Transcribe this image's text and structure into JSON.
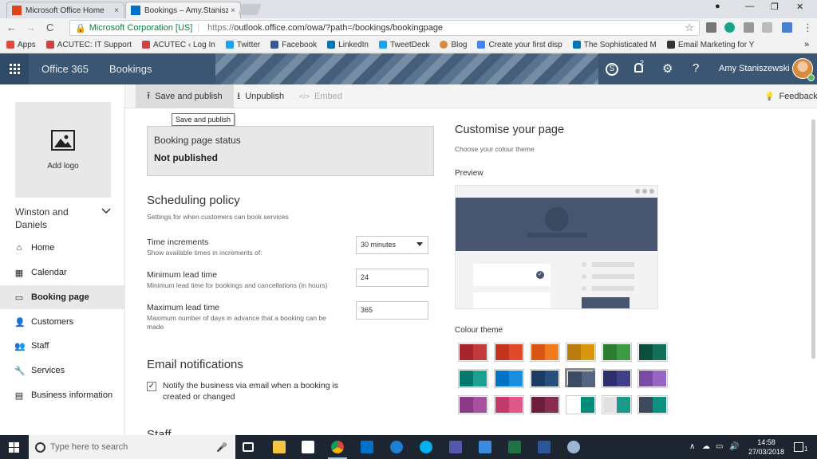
{
  "browser": {
    "tabs": [
      {
        "title": "Microsoft Office Home",
        "close": "×"
      },
      {
        "title": "Bookings – Amy.Stanisze",
        "close": "×"
      }
    ],
    "window_controls": {
      "user": "●",
      "minimize": "—",
      "maximize": "❐",
      "close": "✕"
    },
    "nav": {
      "back": "←",
      "forward": "→",
      "reload": "C"
    },
    "secure_label": "Microsoft Corporation [US]",
    "url_scheme": "https://",
    "url_rest": "outlook.office.com/owa/?path=/bookings/bookingpage",
    "star": "☆",
    "menu": "⋮",
    "bookmarks": [
      {
        "label": "Apps",
        "color": "#e04b3a"
      },
      {
        "label": "ACUTEC: IT Support",
        "color": "#c44"
      },
      {
        "label": "ACUTEC ‹ Log In",
        "color": "#c44"
      },
      {
        "label": "Twitter",
        "color": "#1da1f2"
      },
      {
        "label": "Facebook",
        "color": "#3b5998"
      },
      {
        "label": "LinkedIn",
        "color": "#0077b5"
      },
      {
        "label": "TweetDeck",
        "color": "#1da1f2"
      },
      {
        "label": "Blog",
        "color": "#d98b3a"
      },
      {
        "label": "Create your first disp",
        "color": "#4285f4"
      },
      {
        "label": "The Sophisticated M",
        "color": "#0077b5"
      },
      {
        "label": "Email Marketing for Y",
        "color": "#333"
      }
    ],
    "bookmarks_more": "»"
  },
  "o365": {
    "brand": "Office 365",
    "app": "Bookings",
    "notification_count": "2",
    "icons": {
      "skype": "S",
      "bell": "🔔",
      "settings": "⚙",
      "help": "?"
    },
    "user_name": "Amy Staniszewski"
  },
  "sidebar": {
    "add_logo": "Add logo",
    "business_name": "Winston and Daniels",
    "chevron": "⌄",
    "items": [
      {
        "label": "Home",
        "icon": "⌂"
      },
      {
        "label": "Calendar",
        "icon": "▦"
      },
      {
        "label": "Booking page",
        "icon": "▭"
      },
      {
        "label": "Customers",
        "icon": "👤"
      },
      {
        "label": "Staff",
        "icon": "👥"
      },
      {
        "label": "Services",
        "icon": "🔧"
      },
      {
        "label": "Business information",
        "icon": "▤"
      }
    ]
  },
  "actionbar": {
    "save_publish": "Save and publish",
    "save_icon": "⭱",
    "unpublish": "Unpublish",
    "unpublish_icon": "⭳",
    "embed": "Embed",
    "embed_icon": "</>",
    "feedback": "Feedback",
    "feedback_icon": "💡",
    "tooltip": "Save and publish"
  },
  "status": {
    "title": "Booking page status",
    "value": "Not published"
  },
  "scheduling": {
    "title": "Scheduling policy",
    "subtitle": "Settings for when customers can book services",
    "time_increments": {
      "label": "Time increments",
      "help": "Show available times in increments of:",
      "value": "30 minutes"
    },
    "min_lead": {
      "label": "Minimum lead time",
      "help": "Minimum lead time for bookings and cancellations (in hours)",
      "value": "24"
    },
    "max_lead": {
      "label": "Maximum lead time",
      "help": "Maximum number of days in advance that a booking can be made",
      "value": "365"
    }
  },
  "email": {
    "title": "Email notifications",
    "notify_label": "Notify the business via email when a booking is created or changed",
    "notify_checked": true,
    "check_mark": "✓"
  },
  "next_section": "Staff",
  "customise": {
    "title": "Customise your page",
    "subtitle": "Choose your colour theme",
    "preview_label": "Preview",
    "theme_label": "Colour theme",
    "preview_color": "#475570",
    "swatches": [
      [
        "#a4262c",
        "#c23a3a"
      ],
      [
        "#c5341f",
        "#e04a2b"
      ],
      [
        "#d85611",
        "#f07b1f"
      ],
      [
        "#b97a10",
        "#d9970f"
      ],
      [
        "#2d7d32",
        "#3c9a42"
      ],
      [
        "#0c4f3f",
        "#15705a"
      ],
      [
        "#03786d",
        "#1aa18f"
      ],
      [
        "#0072c6",
        "#1b8ee0"
      ],
      [
        "#1a3c63",
        "#274f7d"
      ],
      [
        "#3d4a63",
        "#556480"
      ],
      [
        "#2b2f6b",
        "#403f8a"
      ],
      [
        "#7a4ca3",
        "#9866c2"
      ],
      [
        "#8a3a86",
        "#a8529f"
      ],
      [
        "#c23a6b",
        "#df5688"
      ],
      [
        "#6b1f3a",
        "#8a2c4f"
      ],
      [
        "#ffffff",
        "#048c7a"
      ],
      [
        "#e1e1e1",
        "#1a9a8a"
      ],
      [
        "#3d4a5c",
        "#0e8f80"
      ]
    ],
    "selected_swatch": 9
  },
  "taskbar": {
    "search_placeholder": "Type here to search",
    "time": "14:58",
    "date": "27/03/2018",
    "notification_count": "1"
  }
}
